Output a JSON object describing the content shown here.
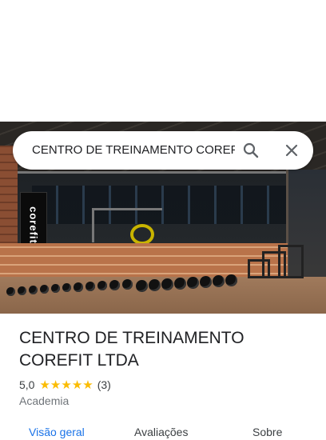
{
  "search": {
    "value": "CENTRO DE TREINAMENTO COREFI",
    "search_icon": "search-icon",
    "close_icon": "close-icon"
  },
  "photo": {
    "banner_text": "corefit"
  },
  "place": {
    "title_line1": "CENTRO DE TREINAMENTO",
    "title_line2": "COREFIT LTDA",
    "rating": "5,0",
    "stars": 5,
    "review_count": "(3)",
    "category": "Academia"
  },
  "tabs": [
    {
      "label": "Visão geral",
      "active": true
    },
    {
      "label": "Avaliações",
      "active": false
    },
    {
      "label": "Sobre",
      "active": false
    }
  ],
  "colors": {
    "accent": "#1a73e8",
    "star": "#fbbc04"
  }
}
